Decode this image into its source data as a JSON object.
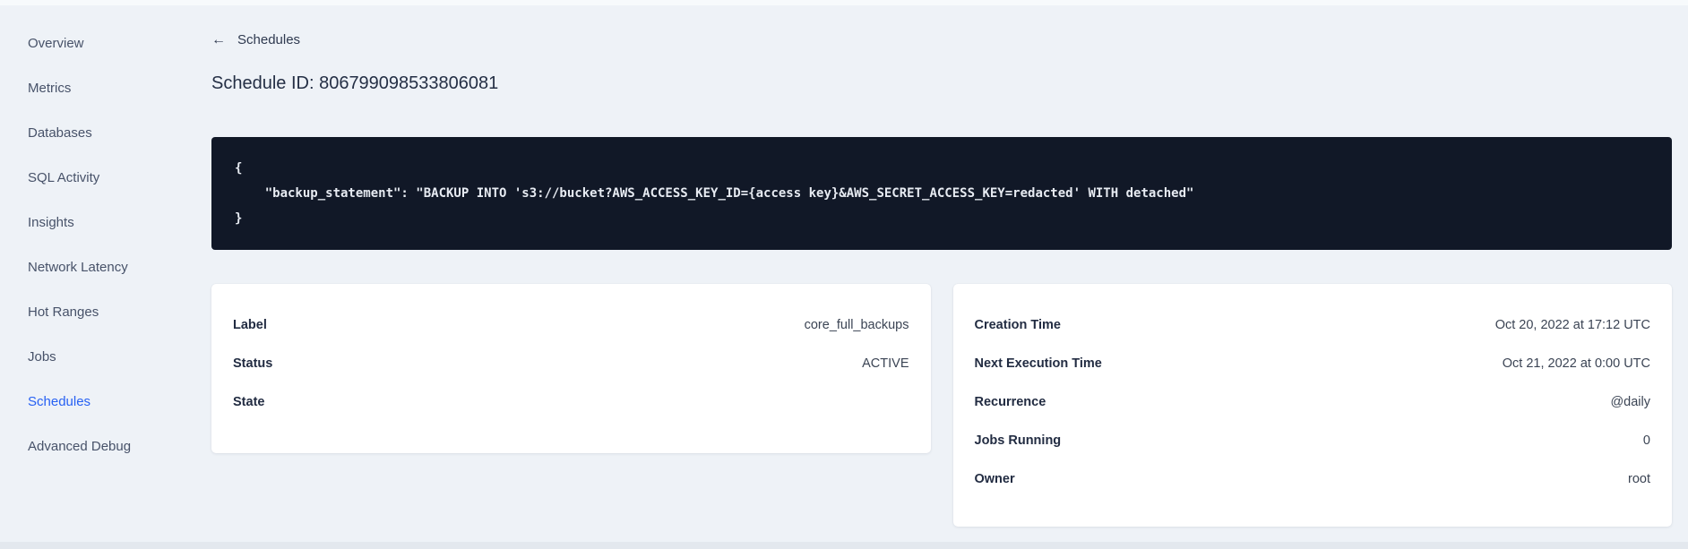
{
  "sidebar": {
    "items": [
      "Overview",
      "Metrics",
      "Databases",
      "SQL Activity",
      "Insights",
      "Network Latency",
      "Hot Ranges",
      "Jobs",
      "Schedules",
      "Advanced Debug"
    ],
    "active_item": "Schedules",
    "active_color": "#2761f3",
    "text_color": "#475269"
  },
  "header": {
    "back_label": "Schedules",
    "title": "Schedule ID: 806799098533806081"
  },
  "icons": {
    "back_arrow": "←"
  },
  "code_block": {
    "text": "{\n    \"backup_statement\": \"BACKUP INTO 's3://bucket?AWS_ACCESS_KEY_ID={access key}&AWS_SECRET_ACCESS_KEY=redacted' WITH detached\"\n}",
    "background": "#111827",
    "text_color": "#e7ebf2"
  },
  "cards": {
    "left": {
      "rows": [
        {
          "label": "Label",
          "value": "core_full_backups"
        },
        {
          "label": "Status",
          "value": "ACTIVE"
        },
        {
          "label": "State",
          "value": ""
        }
      ]
    },
    "right": {
      "rows": [
        {
          "label": "Creation Time",
          "value": "Oct 20, 2022 at 17:12 UTC"
        },
        {
          "label": "Next Execution Time",
          "value": "Oct 21, 2022 at 0:00 UTC"
        },
        {
          "label": "Recurrence",
          "value": "@daily"
        },
        {
          "label": "Jobs Running",
          "value": "0"
        },
        {
          "label": "Owner",
          "value": "root"
        }
      ]
    }
  },
  "colors": {
    "page_background": "#eef2f7",
    "card_background": "#ffffff",
    "title_text": "#242f45"
  }
}
